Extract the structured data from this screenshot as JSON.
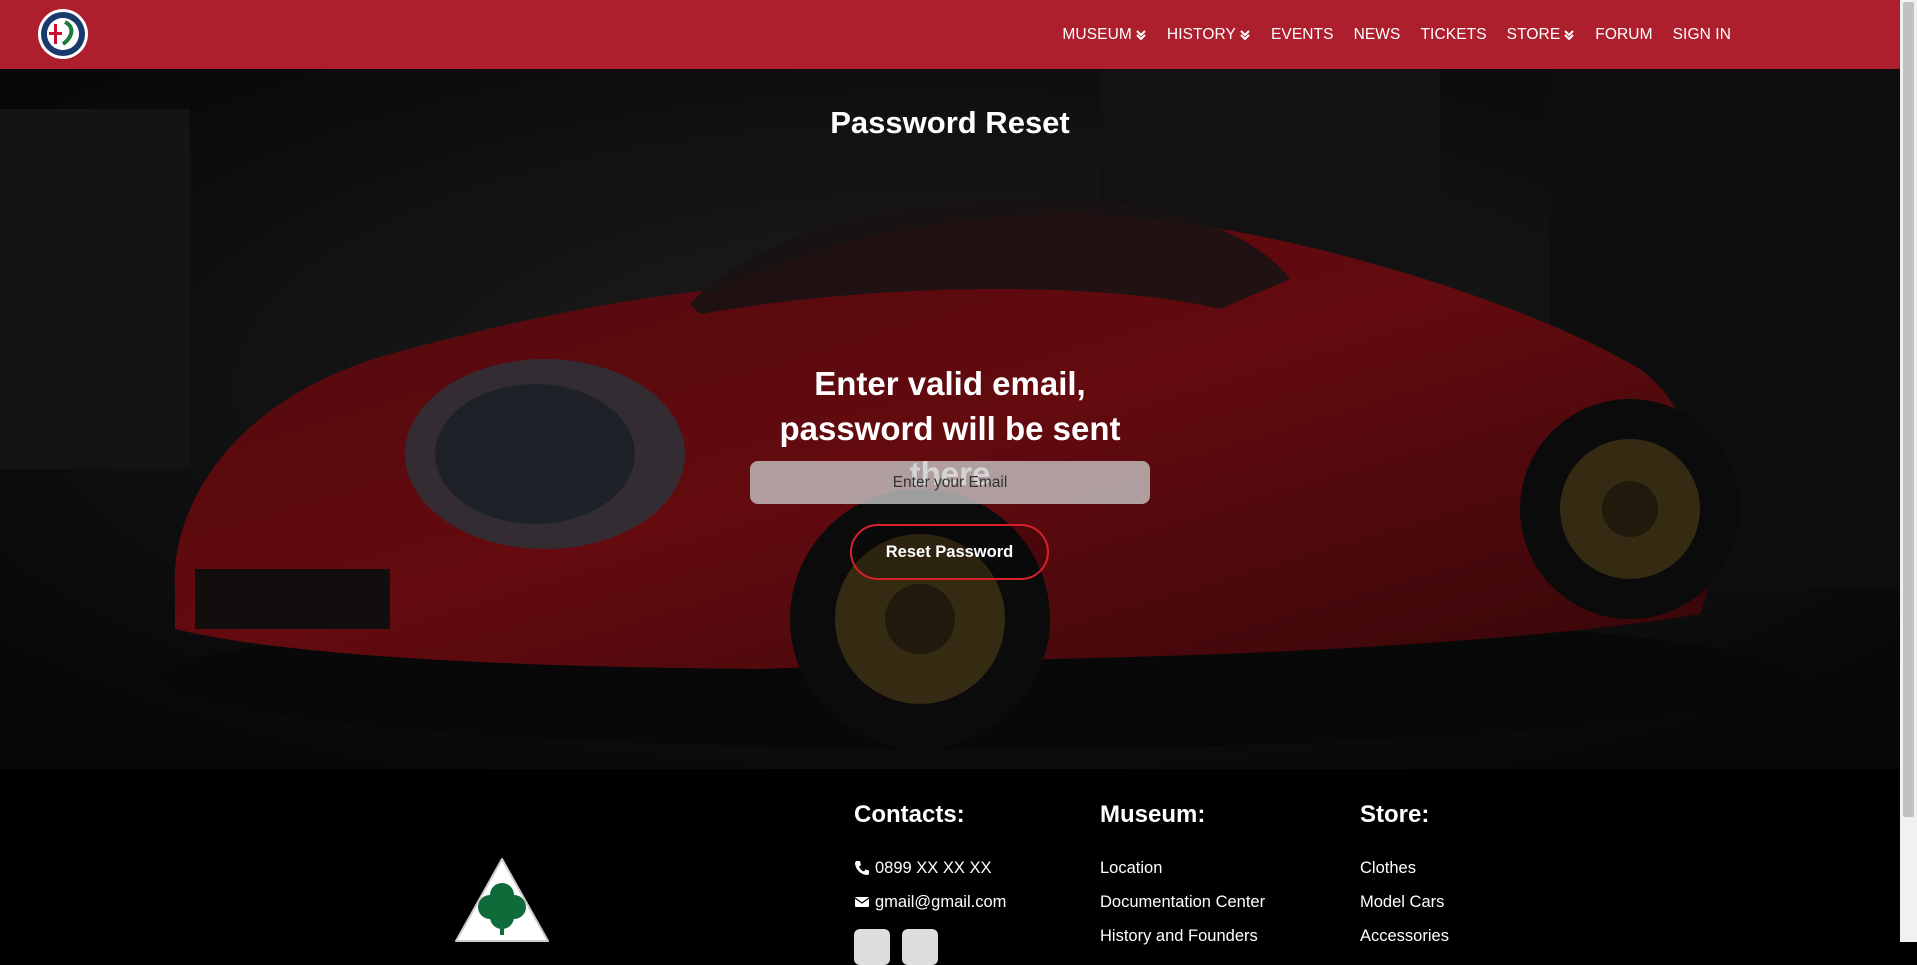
{
  "brand": {
    "logo_icon": "alfa-romeo-badge-icon"
  },
  "nav": {
    "items": [
      {
        "label": "MUSEUM",
        "has_dropdown": true
      },
      {
        "label": "HISTORY",
        "has_dropdown": true
      },
      {
        "label": "EVENTS",
        "has_dropdown": false
      },
      {
        "label": "NEWS",
        "has_dropdown": false
      },
      {
        "label": "TICKETS",
        "has_dropdown": false
      },
      {
        "label": "STORE",
        "has_dropdown": true
      },
      {
        "label": "FORUM",
        "has_dropdown": false
      },
      {
        "label": "SIGN IN",
        "has_dropdown": false
      }
    ],
    "dropdown_icon": "double-chevron-down-icon"
  },
  "hero": {
    "title": "Password Reset",
    "form": {
      "heading": "Enter valid email, password will be sent there",
      "email_placeholder": "Enter your Email",
      "email_value": "",
      "submit_label": "Reset Password"
    }
  },
  "footer": {
    "logo_icon": "quadrifoglio-clover-icon",
    "contacts": {
      "heading": "Contacts:",
      "phone": "0899 XX XX XX",
      "email": "gmail@gmail.com",
      "social_icons": [
        "social-icon-1",
        "social-icon-2"
      ]
    },
    "museum": {
      "heading": "Museum:",
      "links": [
        "Location",
        "Documentation Center",
        "History and Founders"
      ]
    },
    "store": {
      "heading": "Store:",
      "links": [
        "Clothes",
        "Model Cars",
        "Accessories"
      ]
    }
  },
  "colors": {
    "navbar": "#ad1f2d",
    "accent_red": "#d8202c",
    "footer_bg": "#000000"
  }
}
